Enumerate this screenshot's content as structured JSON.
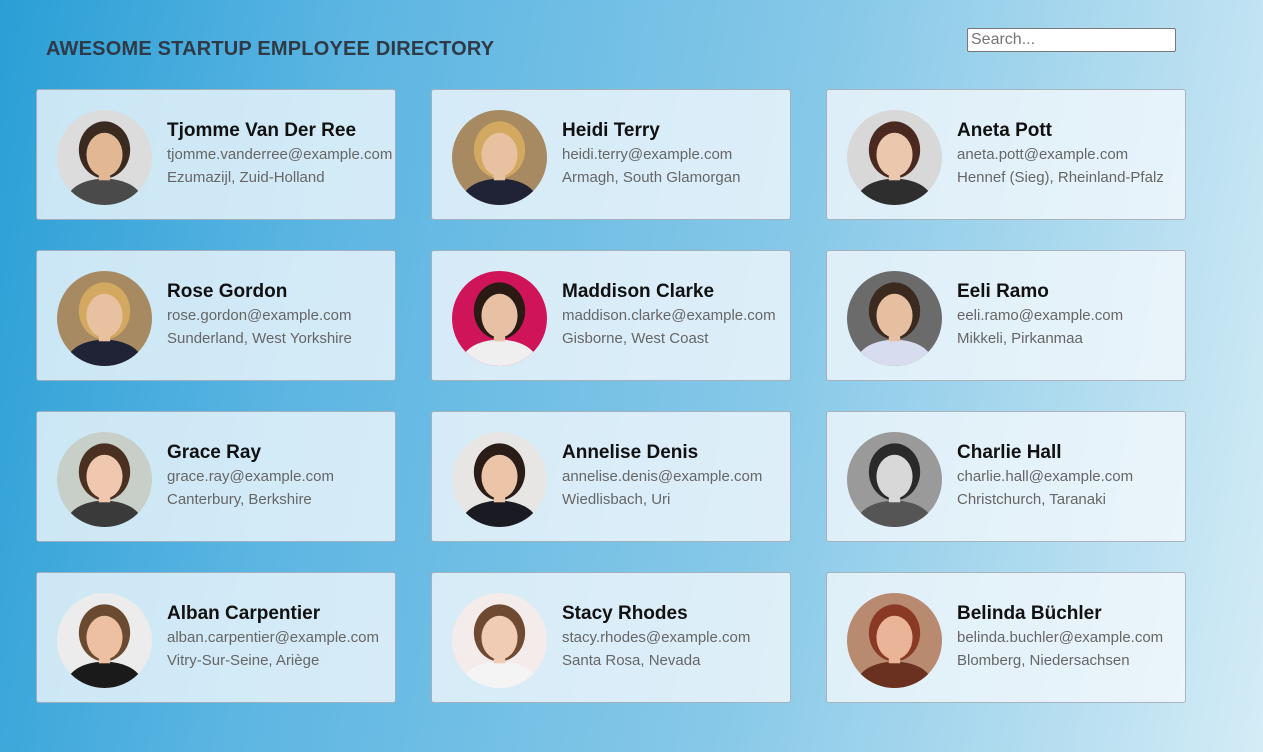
{
  "header": {
    "title": "AWESOME STARTUP EMPLOYEE DIRECTORY",
    "search_placeholder": "Search..."
  },
  "employees": [
    {
      "name": "Tjomme Van Der Ree",
      "email": "tjomme.vanderree@example.com",
      "location": "Ezumazijl, Zuid-Holland",
      "avatar": {
        "bg": "#dcdcdc",
        "skin": "#e2b894",
        "hair": "#3a2a20",
        "shirt": "#4a4a4a"
      }
    },
    {
      "name": "Heidi Terry",
      "email": "heidi.terry@example.com",
      "location": "Armagh, South Glamorgan",
      "avatar": {
        "bg": "#a88a62",
        "skin": "#e8c2a0",
        "hair": "#d3a861",
        "shirt": "#1f2335"
      }
    },
    {
      "name": "Aneta Pott",
      "email": "aneta.pott@example.com",
      "location": "Hennef (Sieg), Rheinland-Pfalz",
      "avatar": {
        "bg": "#d8d8d8",
        "skin": "#eac7ad",
        "hair": "#4a2a20",
        "shirt": "#2e2e2e"
      }
    },
    {
      "name": "Rose Gordon",
      "email": "rose.gordon@example.com",
      "location": "Sunderland, West Yorkshire",
      "avatar": {
        "bg": "#a88a62",
        "skin": "#e8c2a0",
        "hair": "#d3a861",
        "shirt": "#1f2335"
      }
    },
    {
      "name": "Maddison Clarke",
      "email": "maddison.clarke@example.com",
      "location": "Gisborne, West Coast",
      "avatar": {
        "bg": "#d0145a",
        "skin": "#e8c0a4",
        "hair": "#2a1a14",
        "shirt": "#efefef"
      }
    },
    {
      "name": "Eeli Ramo",
      "email": "eeli.ramo@example.com",
      "location": "Mikkeli, Pirkanmaa",
      "avatar": {
        "bg": "#6b6b6b",
        "skin": "#e6bfa0",
        "hair": "#3a2a20",
        "shirt": "#d8dcef"
      }
    },
    {
      "name": "Grace Ray",
      "email": "grace.ray@example.com",
      "location": "Canterbury, Berkshire",
      "avatar": {
        "bg": "#c8cfc8",
        "skin": "#f0c8b0",
        "hair": "#4a3020",
        "shirt": "#3a3a3a"
      }
    },
    {
      "name": "Annelise Denis",
      "email": "annelise.denis@example.com",
      "location": "Wiedlisbach, Uri",
      "avatar": {
        "bg": "#e8e6e4",
        "skin": "#ecc4a8",
        "hair": "#2a1c16",
        "shirt": "#1a1a22"
      }
    },
    {
      "name": "Charlie Hall",
      "email": "charlie.hall@example.com",
      "location": "Christchurch, Taranaki",
      "avatar": {
        "bg": "#9a9a9a",
        "skin": "#d8d8d8",
        "hair": "#2a2a2a",
        "shirt": "#555555"
      }
    },
    {
      "name": "Alban Carpentier",
      "email": "alban.carpentier@example.com",
      "location": "Vitry-Sur-Seine, Ariège",
      "avatar": {
        "bg": "#ececec",
        "skin": "#ecc0a0",
        "hair": "#6a4a30",
        "shirt": "#1a1a1a"
      }
    },
    {
      "name": "Stacy Rhodes",
      "email": "stacy.rhodes@example.com",
      "location": "Santa Rosa, Nevada",
      "avatar": {
        "bg": "#f4ecea",
        "skin": "#f0ccb4",
        "hair": "#6e4a32",
        "shirt": "#f4f4f4"
      }
    },
    {
      "name": "Belinda Büchler",
      "email": "belinda.buchler@example.com",
      "location": "Blomberg, Niedersachsen",
      "avatar": {
        "bg": "#b88a70",
        "skin": "#eab498",
        "hair": "#8a3a24",
        "shirt": "#6a3020"
      }
    }
  ]
}
